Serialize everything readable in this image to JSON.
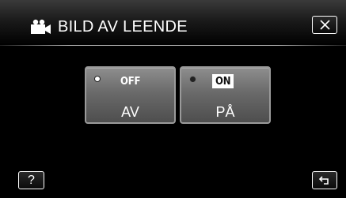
{
  "header": {
    "icon": "movie-camera-icon",
    "title": "BILD AV LEENDE",
    "close_icon": "close-icon"
  },
  "options": [
    {
      "badge": "OFF",
      "label": "AV",
      "selected": true
    },
    {
      "badge": "ON",
      "label": "PÅ",
      "selected": false
    }
  ],
  "footer": {
    "help_label": "?",
    "back_icon": "return-icon"
  }
}
